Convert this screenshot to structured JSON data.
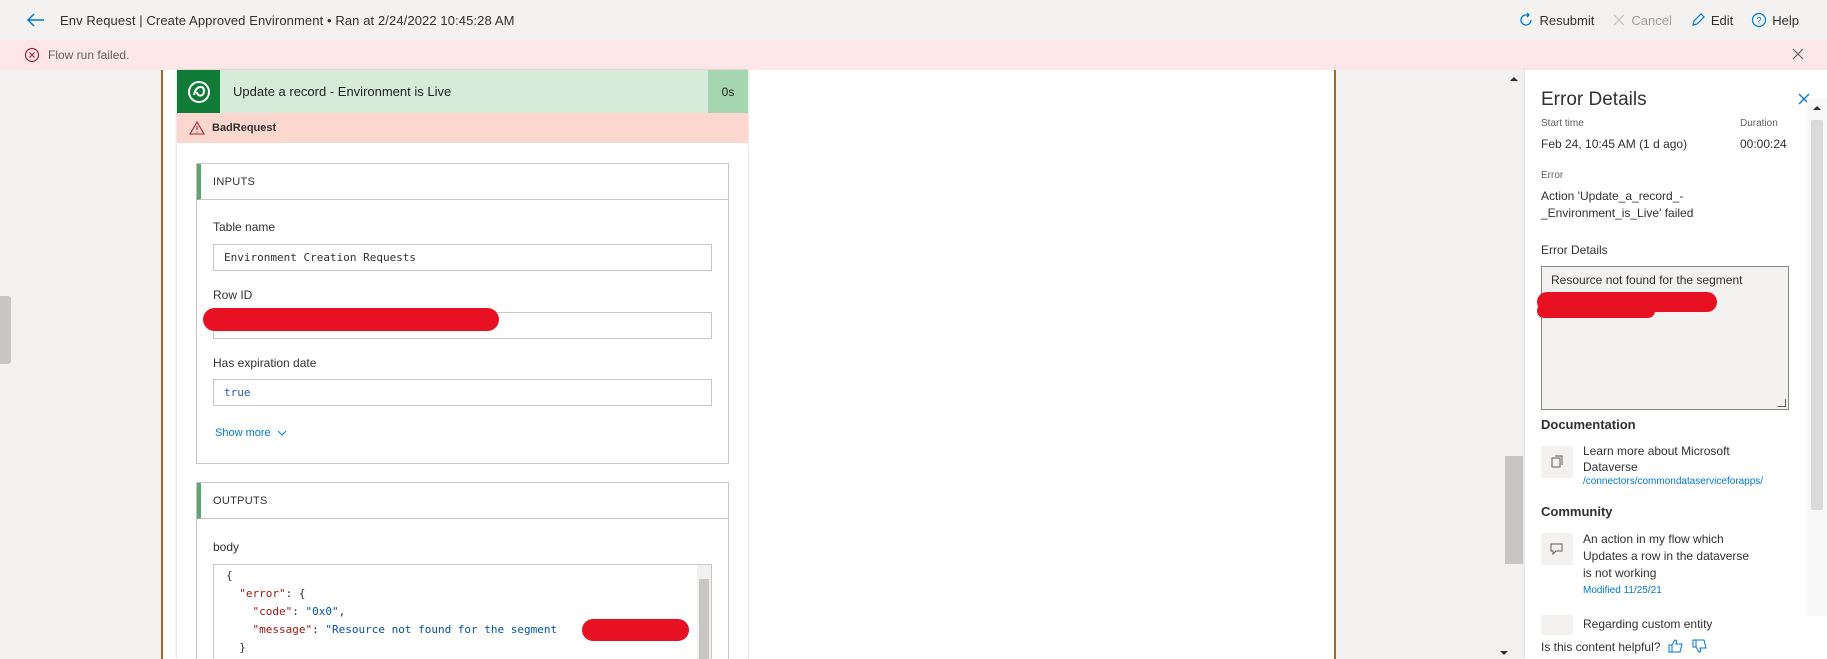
{
  "header": {
    "title": "Env Request | Create Approved Environment • Ran at 2/24/2022 10:45:28 AM",
    "commands": {
      "resubmit": "Resubmit",
      "cancel": "Cancel",
      "edit": "Edit",
      "help": "Help"
    }
  },
  "banner": {
    "message": "Flow run failed."
  },
  "action": {
    "title": "Update a record - Environment is Live",
    "duration": "0s",
    "error_code": "BadRequest",
    "inputs": {
      "heading": "INPUTS",
      "table_name_label": "Table name",
      "table_name_value": "Environment Creation Requests",
      "row_id_label": "Row ID",
      "has_expiration_label": "Has expiration date",
      "has_expiration_value": "true",
      "show_more": "Show more"
    },
    "outputs": {
      "heading": "OUTPUTS",
      "body_label": "body",
      "code_line1": "{",
      "code_error_key": "\"error\"",
      "code_error_rest": ": {",
      "code_code_key": "\"code\"",
      "code_code_val": "\"0x0\"",
      "code_message_key": "\"message\"",
      "code_message_val": "\"Resource not found for the segment",
      "code_close": "}"
    }
  },
  "panel": {
    "title": "Error Details",
    "start_time_label": "Start time",
    "start_time_value": "Feb 24, 10:45 AM (1 d ago)",
    "duration_label": "Duration",
    "duration_value": "00:00:24",
    "error_label": "Error",
    "error_value_line1": "Action 'Update_a_record_-",
    "error_value_line2": "_Environment_is_Live' failed",
    "error_details_label": "Error Details",
    "error_details_text": "Resource not found for the segment",
    "documentation_heading": "Documentation",
    "doc_link_line1": "Learn more about Microsoft",
    "doc_link_line2": "Dataverse",
    "doc_url": "/connectors/commondataserviceforapps/",
    "community_heading": "Community",
    "community_item_line1": "An action in my flow which",
    "community_item_line2": "Updates a row in the dataverse",
    "community_item_line3": "is not working",
    "community_item_modified": "Modified 11/25/21",
    "community_item2": "Regarding custom entity",
    "helpful_prompt": "Is this content helpful?"
  }
}
